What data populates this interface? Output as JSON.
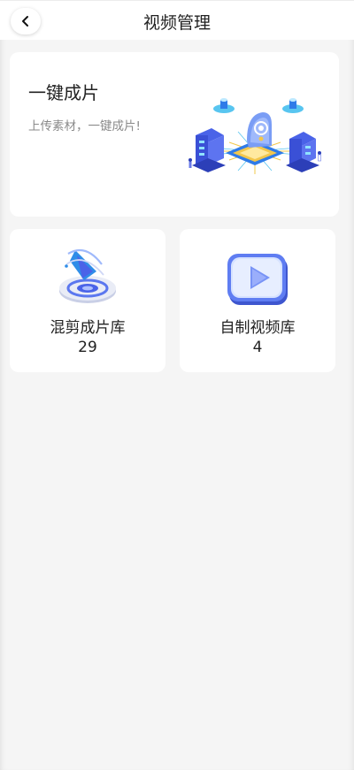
{
  "header": {
    "title": "视频管理",
    "back_icon": "chevron-left-icon"
  },
  "hero": {
    "title": "一键成片",
    "subtitle": "上传素材，一键成片!",
    "illustration": "isometric-ai-chip-servers-illustration"
  },
  "libraries": [
    {
      "label": "混剪成片库",
      "count": "29",
      "icon": "mix-cut-library-icon"
    },
    {
      "label": "自制视频库",
      "count": "4",
      "icon": "play-video-library-icon"
    }
  ],
  "colors": {
    "page_bg": "#f5f5f5",
    "card_bg": "#ffffff",
    "accent_blue": "#4a63e8"
  }
}
